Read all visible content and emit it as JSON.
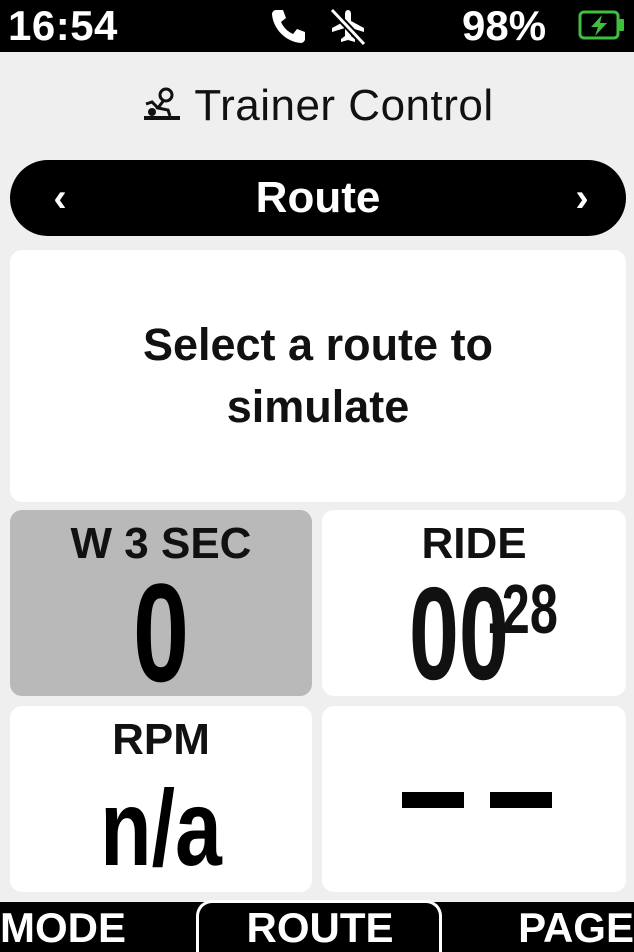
{
  "status": {
    "time": "16:54",
    "battery_percent": "98%",
    "icons": [
      "phone-icon",
      "airplane-mode-off-icon",
      "battery-charging-icon"
    ]
  },
  "header": {
    "title": "Trainer Control",
    "icon": "trainer-icon"
  },
  "selector": {
    "label": "Route",
    "prev_glyph": "‹",
    "next_glyph": "›"
  },
  "message": {
    "text": "Select a route to simulate"
  },
  "tiles": {
    "power": {
      "label": "W 3 SEC",
      "value": "0"
    },
    "ride": {
      "label": "RIDE",
      "value_main": "00",
      "value_sup": ":28"
    },
    "rpm": {
      "label": "RPM",
      "value": "n/a"
    },
    "blank": {
      "value": "--"
    }
  },
  "bottom": {
    "left": "MODE",
    "center": "ROUTE",
    "right": "PAGE"
  },
  "colors": {
    "background": "#efefef",
    "tile": "#ffffff",
    "highlight_tile": "#b9b9b9",
    "bar": "#000000",
    "battery": "#3fbf3f"
  }
}
